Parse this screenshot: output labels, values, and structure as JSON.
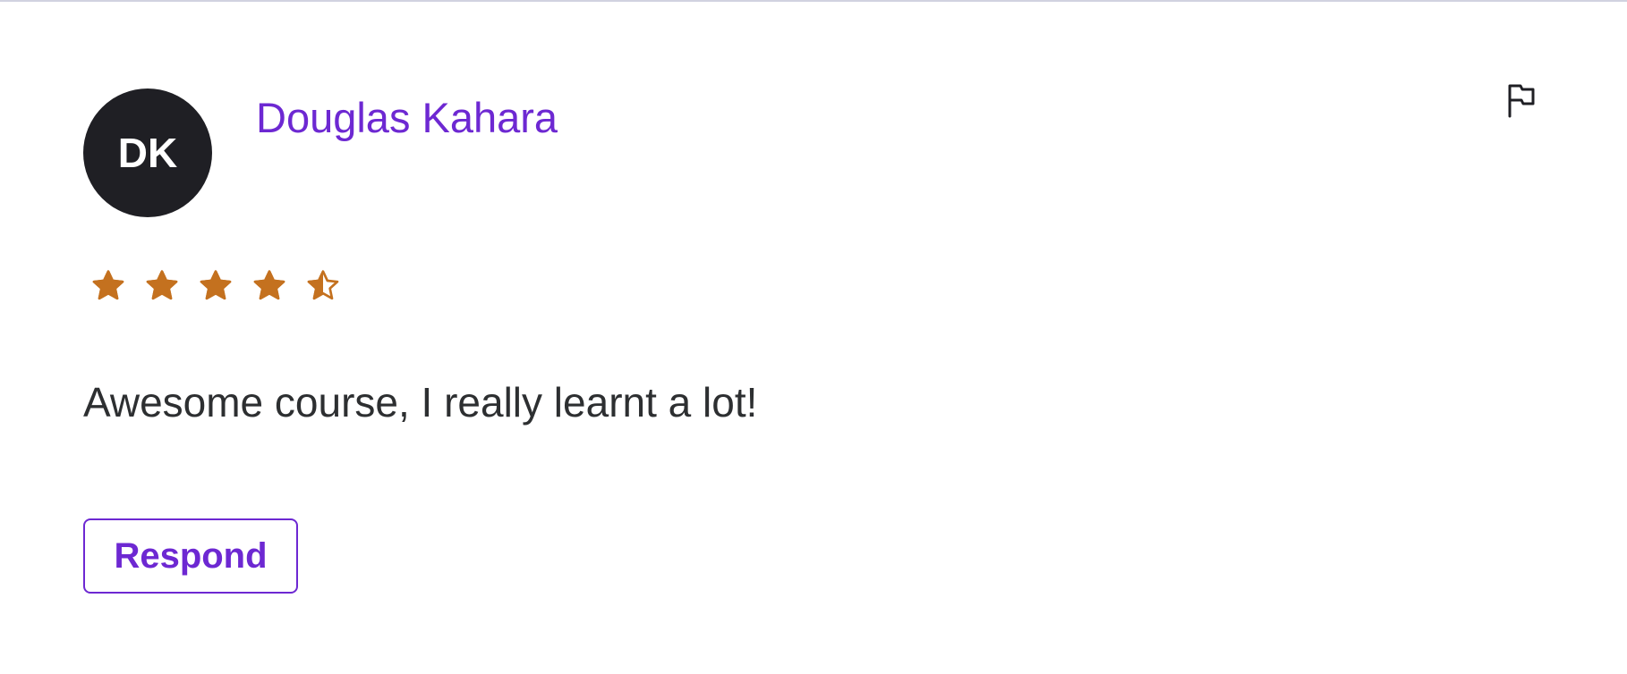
{
  "review": {
    "avatar_initials": "DK",
    "reviewer_name": "Douglas Kahara",
    "rating": 4.5,
    "rating_max": 5,
    "text": "Awesome course, I really learnt a lot!",
    "respond_label": "Respond"
  },
  "icons": {
    "flag": "flag-icon",
    "star": "star-icon"
  },
  "colors": {
    "accent": "#6d28d2",
    "avatar_bg": "#1f1f24",
    "star": "#c4711f",
    "text": "#2d2f31",
    "divider": "#d1d2e0"
  }
}
